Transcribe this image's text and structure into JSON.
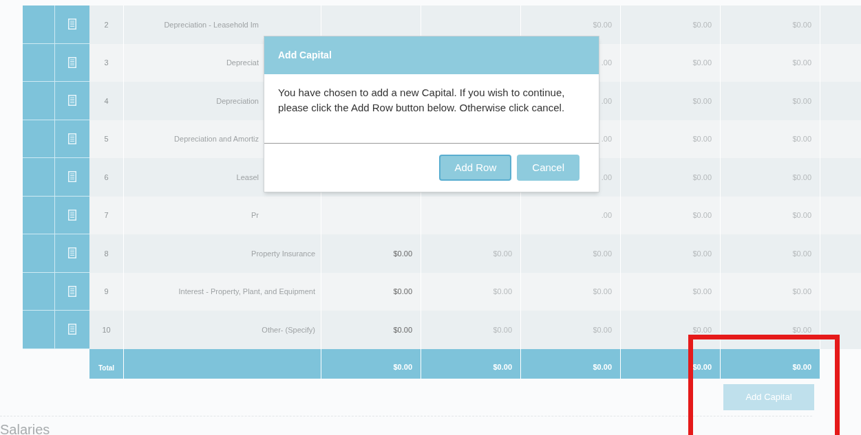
{
  "table": {
    "rows": [
      {
        "number": "2",
        "label": "Depreciation - Leasehold Im",
        "c": "$0.00",
        "d": "$0.00",
        "e": "$0.00"
      },
      {
        "number": "3",
        "label": "Depreciat",
        "c": ".00",
        "d": "$0.00",
        "e": "$0.00"
      },
      {
        "number": "4",
        "label": "Depreciation",
        "c": ".00",
        "d": "$0.00",
        "e": "$0.00"
      },
      {
        "number": "5",
        "label": "Depreciation and Amortiz",
        "c": ".00",
        "d": "$0.00",
        "e": "$0.00"
      },
      {
        "number": "6",
        "label": "Leasel",
        "c": ".00",
        "d": "$0.00",
        "e": "$0.00"
      },
      {
        "number": "7",
        "label": "Pr",
        "c": ".00",
        "d": "$0.00",
        "e": "$0.00"
      },
      {
        "number": "8",
        "label": "Property Insurance",
        "a": "$0.00",
        "b": "$0.00",
        "c": "$0.00",
        "d": "$0.00",
        "e": "$0.00"
      },
      {
        "number": "9",
        "label": "Interest - Property, Plant, and Equipment",
        "a": "$0.00",
        "b": "$0.00",
        "c": "$0.00",
        "d": "$0.00",
        "e": "$0.00"
      },
      {
        "number": "10",
        "label": "Other- (Specify)",
        "a": "$0.00",
        "b": "$0.00",
        "c": "$0.00",
        "d": "$0.00",
        "e": "$0.00"
      }
    ],
    "total": {
      "label": "Total",
      "values": [
        "$0.00",
        "$0.00",
        "$0.00",
        "$0.00",
        "$0.00"
      ]
    }
  },
  "add_button": "Add Capital",
  "section_heading": "Salaries",
  "dialog": {
    "title": "Add Capital",
    "message": "You have chosen to add a new Capital. If you wish to continue, please click the Add Row button below. Otherwise click cancel.",
    "buttons": [
      {
        "label": "Add Row",
        "selected": true
      },
      {
        "label": "Cancel",
        "selected": false
      }
    ]
  }
}
